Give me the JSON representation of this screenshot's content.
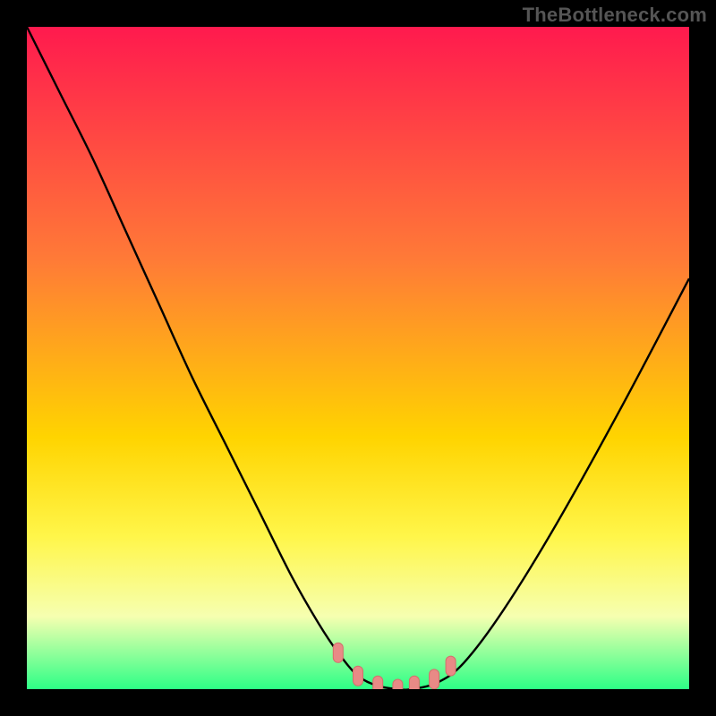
{
  "watermark": "TheBottleneck.com",
  "colors": {
    "stops": [
      "#ff1a4e",
      "#ff7a37",
      "#ffd400",
      "#fff64a",
      "#f6ffb0",
      "#2dff86"
    ],
    "positions": [
      0.0,
      0.35,
      0.62,
      0.77,
      0.89,
      1.0
    ],
    "curve_stroke": "#000000",
    "marker_fill": "#e88a86",
    "marker_stroke": "#d46e6c",
    "frame": "#000000"
  },
  "layout": {
    "outer_w": 800,
    "outer_h": 800,
    "inner_x": 30,
    "inner_y": 30,
    "inner_w": 740,
    "inner_h": 740
  },
  "chart_data": {
    "type": "line",
    "title": "",
    "xlabel": "",
    "ylabel": "",
    "xlim": [
      0,
      1
    ],
    "ylim": [
      0,
      1
    ],
    "series": [
      {
        "name": "bottleneck-curve",
        "x": [
          0.0,
          0.05,
          0.1,
          0.15,
          0.2,
          0.25,
          0.3,
          0.35,
          0.4,
          0.44,
          0.47,
          0.5,
          0.53,
          0.56,
          0.58,
          0.62,
          0.66,
          0.72,
          0.8,
          0.9,
          1.0
        ],
        "y": [
          1.0,
          0.9,
          0.8,
          0.69,
          0.58,
          0.47,
          0.37,
          0.27,
          0.17,
          0.1,
          0.055,
          0.02,
          0.005,
          0.0,
          0.0,
          0.01,
          0.04,
          0.12,
          0.25,
          0.43,
          0.62
        ]
      }
    ],
    "markers": {
      "name": "optimal-zone-markers",
      "x": [
        0.47,
        0.5,
        0.53,
        0.56,
        0.585,
        0.615,
        0.64
      ],
      "y": [
        0.055,
        0.02,
        0.005,
        0.0,
        0.005,
        0.015,
        0.035
      ]
    }
  }
}
